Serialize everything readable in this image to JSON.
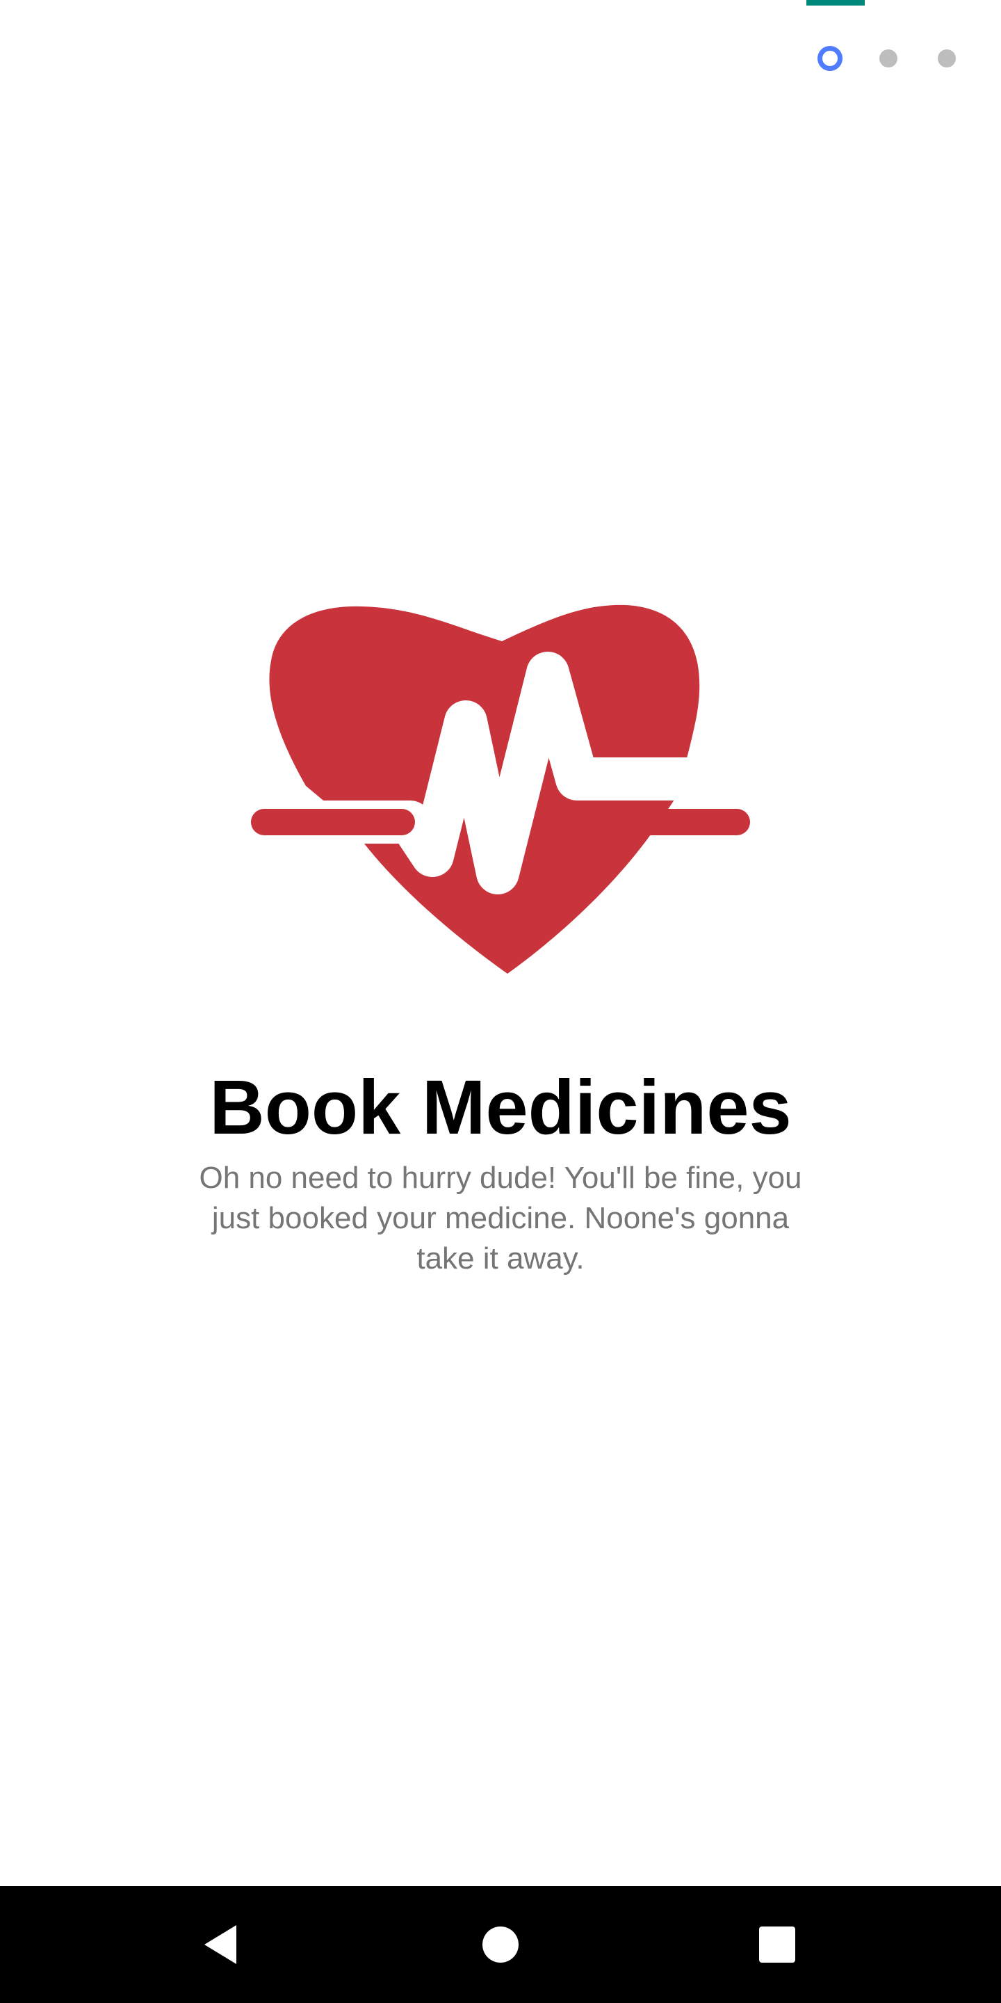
{
  "onboarding": {
    "title": "Book Medicines",
    "description": "Oh no need to hurry dude! You'll be fine, you just booked your medicine. Noone's gonna take it away.",
    "illustration": "heart-pulse-icon",
    "pager": {
      "total": 3,
      "current": 1
    }
  },
  "colors": {
    "accent_tab": "#00897b",
    "active_dot": "#4f7cff",
    "inactive_dot": "#bdbdbd",
    "heart": "#c9333b",
    "description_text": "#757575"
  },
  "nav_bar": {
    "back": "back-triangle-icon",
    "home": "home-circle-icon",
    "recents": "recents-square-icon"
  }
}
